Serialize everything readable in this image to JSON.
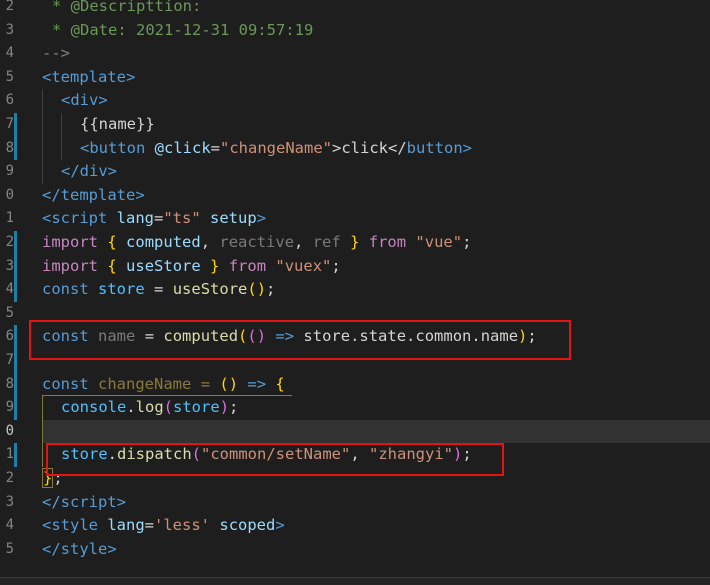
{
  "editor": {
    "line_numbers": [
      "2",
      "3",
      "4",
      "5",
      "6",
      "7",
      "8",
      "9",
      "0",
      "1",
      "2",
      "3",
      "4",
      "5",
      "6",
      "7",
      "8",
      "9",
      "0",
      "1",
      "2",
      "3",
      "4",
      "5"
    ],
    "lines": {
      "l2": [
        "* @Descripttion:"
      ],
      "l3": [
        "* @Date: 2021-12-31 09:57:19"
      ],
      "l4": [
        "-->"
      ],
      "l5": [
        "<template>"
      ],
      "l6": [
        "<div>"
      ],
      "l7": [
        "{{name}}"
      ],
      "l8": [
        "<button",
        "@click",
        "=",
        "\"changeName\"",
        ">click</",
        "button",
        ">"
      ],
      "l9": [
        "</div>"
      ],
      "l10": [
        "</template>"
      ],
      "l11": [
        "<script",
        "lang",
        "=",
        "\"ts\"",
        "setup",
        ">"
      ],
      "l12": [
        "import",
        "{",
        "computed",
        ",",
        "reactive",
        ",",
        "ref",
        "}",
        "from",
        "\"vue\"",
        ";"
      ],
      "l13": [
        "import",
        "{",
        "useStore",
        "}",
        "from",
        "\"vuex\"",
        ";"
      ],
      "l14": [
        "const",
        "store",
        "=",
        "useStore",
        "()",
        ";"
      ],
      "l16": [
        "const",
        "name",
        "=",
        "computed",
        "(",
        "()",
        "=>",
        "store.state.common.name",
        ")",
        ";"
      ],
      "l18": [
        "const",
        "changeName",
        "=",
        "()",
        "=>",
        "{"
      ],
      "l19": [
        "console",
        ".",
        "log",
        "(",
        "store",
        ")",
        ";"
      ],
      "l21": [
        "store",
        ".",
        "dispatch",
        "(",
        "\"common/setName\"",
        ",",
        "\"zhangyi\"",
        ")",
        ";"
      ],
      "l22": [
        "}",
        ";"
      ],
      "l23": [
        "</",
        "script",
        ">"
      ],
      "l24": [
        "<style",
        "lang",
        "=",
        "'less'",
        "scoped",
        ">"
      ],
      "l25": [
        "</style>"
      ]
    }
  }
}
